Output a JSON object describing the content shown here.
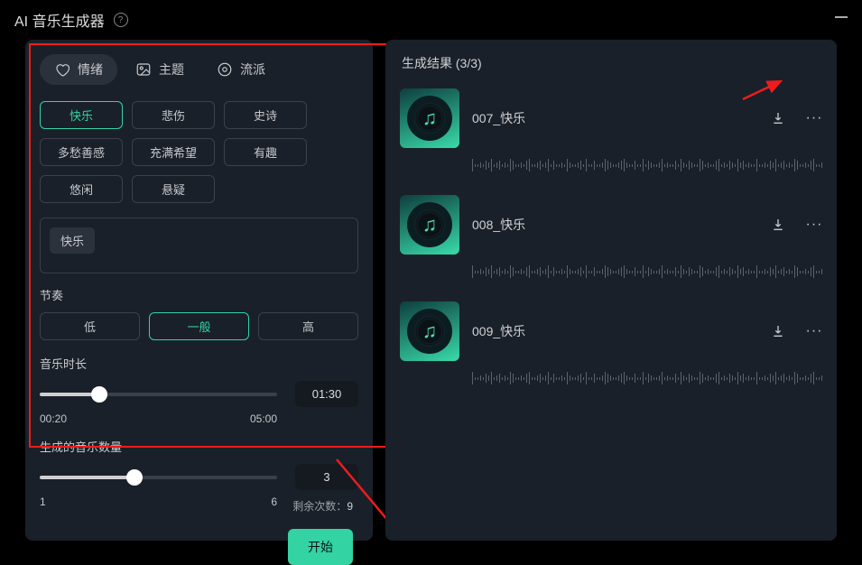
{
  "header": {
    "title": "AI 音乐生成器"
  },
  "tabs": [
    {
      "label": "情绪",
      "icon": "heart",
      "active": true
    },
    {
      "label": "主题",
      "icon": "image",
      "active": false
    },
    {
      "label": "流派",
      "icon": "disc",
      "active": false
    }
  ],
  "mood_chips": [
    {
      "label": "快乐",
      "active": true
    },
    {
      "label": "悲伤",
      "active": false
    },
    {
      "label": "史诗",
      "active": false
    },
    {
      "label": "多愁善感",
      "active": false
    },
    {
      "label": "充满希望",
      "active": false
    },
    {
      "label": "有趣",
      "active": false
    },
    {
      "label": "悠闲",
      "active": false
    },
    {
      "label": "悬疑",
      "active": false
    }
  ],
  "selected_tag": {
    "label": "快乐"
  },
  "tempo": {
    "label": "节奏",
    "options": [
      {
        "label": "低",
        "active": false
      },
      {
        "label": "一般",
        "active": true
      },
      {
        "label": "高",
        "active": false
      }
    ]
  },
  "duration": {
    "label": "音乐时长",
    "min_label": "00:20",
    "max_label": "05:00",
    "value": "01:30",
    "percent": 25
  },
  "count": {
    "label": "生成的音乐数量",
    "min_label": "1",
    "max_label": "6",
    "value": "3",
    "percent": 40
  },
  "remaining": {
    "label": "剩余次数：",
    "value": "9"
  },
  "start_button": {
    "label": "开始"
  },
  "results": {
    "title": "生成结果 (3/3)",
    "items": [
      {
        "title": "007_快乐"
      },
      {
        "title": "008_快乐"
      },
      {
        "title": "009_快乐"
      }
    ]
  }
}
